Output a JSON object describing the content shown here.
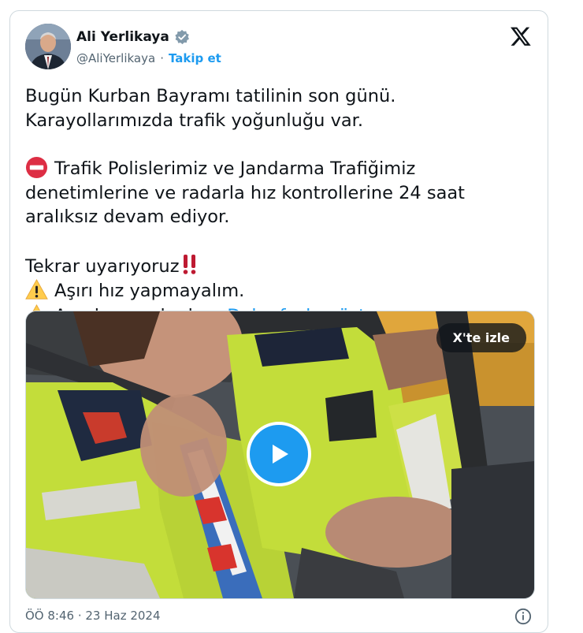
{
  "author": {
    "name": "Ali Yerlikaya",
    "handle": "@AliYerlikaya",
    "separator": "·",
    "follow_label": "Takip et",
    "verified_icon": "verified-badge-icon"
  },
  "post": {
    "line1": "Bugün Kurban Bayramı tatilinin son günü. Karayollarımızda trafik yoğunluğu var.",
    "line2": "Trafik Polislerimiz ve Jandarma Trafiğimiz denetimlerine ve radarla hız kontrollerine 24 saat aralıksız devam ediyor.",
    "line3": "Tekrar uyarıyoruz",
    "line4": "Aşırı hız yapmayalım.",
    "line5": "Araçlarımızda da…",
    "show_more": "Daha fazla göster"
  },
  "video": {
    "watch_label": "X'te izle"
  },
  "footer": {
    "timestamp": "ÖÖ 8:46 · 23 Haz 2024"
  },
  "colors": {
    "accent": "#1d9bf0",
    "text": "#0f1419",
    "muted": "#536471",
    "vest": "#c8e83c"
  }
}
